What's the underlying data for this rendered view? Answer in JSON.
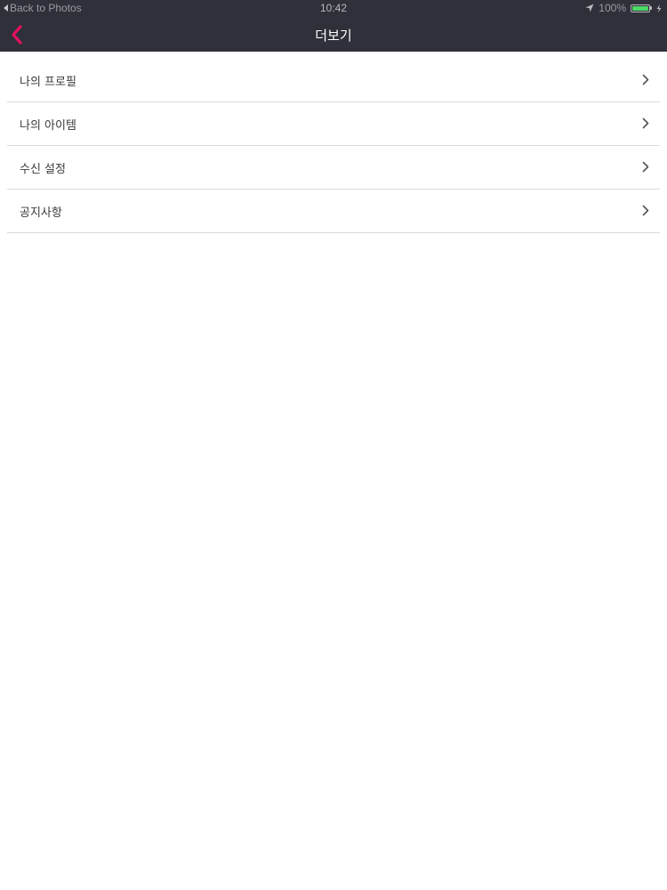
{
  "status_bar": {
    "back_label": "Back to Photos",
    "time": "10:42",
    "battery_text": "100%",
    "battery_level": 1.0,
    "battery_color": "#4cd964"
  },
  "nav": {
    "title": "더보기",
    "back_icon": "chevron-left-icon",
    "background": "#2f3039",
    "accent": "#e0115f"
  },
  "menu": {
    "items": [
      {
        "label": "나의 프로필",
        "icon": "chevron-right-icon"
      },
      {
        "label": "나의 아이템",
        "icon": "chevron-right-icon"
      },
      {
        "label": "수신 설정",
        "icon": "chevron-right-icon"
      },
      {
        "label": "공지사항",
        "icon": "chevron-right-icon"
      }
    ]
  }
}
